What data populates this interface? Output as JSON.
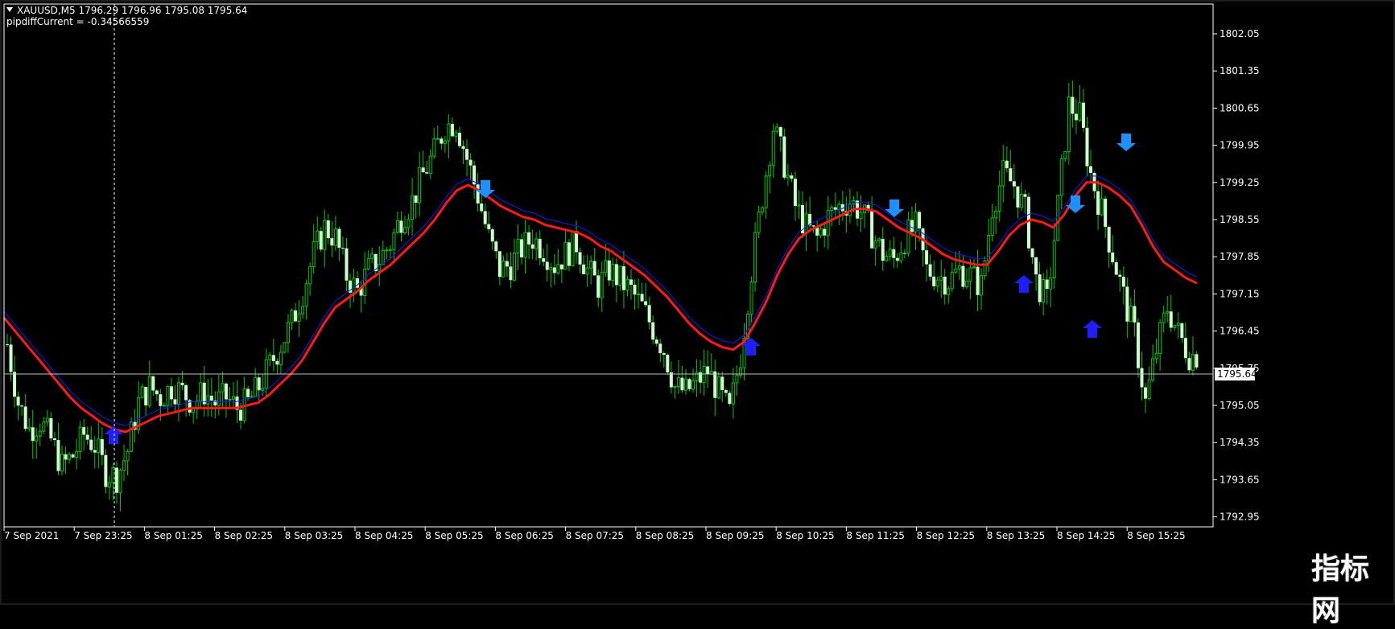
{
  "header": {
    "symbol_line": "XAUUSD,M5  1796.29 1796.96 1795.08 1795.64",
    "indicator_line": "pipdiffCurrent = -0.34566559"
  },
  "current_price_label": "1795.64",
  "watermark_text": "指标网",
  "colors": {
    "background": "#000000",
    "grid_frame": "#ffffff",
    "candle_up_body": "#000000",
    "candle_wick": "#00c800",
    "candle_down_body": "#ccffcc",
    "ema_red": "#ff1a1a",
    "ema_blue": "#1a1aff",
    "arrow_up": "#1e1eff",
    "arrow_down": "#1e90ff",
    "price_line": "#c0c0c0"
  },
  "chart_data": {
    "type": "candlestick",
    "symbol": "XAUUSD",
    "timeframe": "M5",
    "ylim": [
      1792.6,
      1802.4
    ],
    "y_ticks": [
      "1802.05",
      "1801.35",
      "1800.65",
      "1799.95",
      "1799.25",
      "1798.55",
      "1797.85",
      "1797.15",
      "1796.45",
      "1795.75",
      "1795.05",
      "1794.35",
      "1793.65",
      "1792.95"
    ],
    "x_ticks": [
      "7 Sep 2021",
      "7 Sep 23:25",
      "8 Sep 01:25",
      "8 Sep 02:25",
      "8 Sep 03:25",
      "8 Sep 04:25",
      "8 Sep 05:25",
      "8 Sep 06:25",
      "8 Sep 07:25",
      "8 Sep 08:25",
      "8 Sep 09:25",
      "8 Sep 10:25",
      "8 Sep 11:25",
      "8 Sep 12:25",
      "8 Sep 13:25",
      "8 Sep 14:25",
      "8 Sep 15:25"
    ],
    "current_price": 1795.64,
    "close_path": [
      1796.2,
      1795.1,
      1794.6,
      1794.75,
      1794.4,
      1793.9,
      1794.1,
      1794.5,
      1794.3,
      1793.8,
      1793.7,
      1794.2,
      1795.1,
      1795.4,
      1795.2,
      1795.4,
      1795.3,
      1795.1,
      1795.3,
      1795.1,
      1795.2,
      1795.0,
      1795.1,
      1795.4,
      1795.8,
      1796.2,
      1796.6,
      1797.2,
      1797.9,
      1798.4,
      1798.2,
      1797.5,
      1797.2,
      1797.6,
      1797.8,
      1798.1,
      1798.6,
      1798.9,
      1799.4,
      1799.8,
      1800.3,
      1800.4,
      1799.7,
      1799.0,
      1798.2,
      1797.6,
      1797.7,
      1798.0,
      1798.2,
      1798.0,
      1797.7,
      1797.9,
      1798.1,
      1797.6,
      1797.3,
      1797.6,
      1797.4,
      1797.2,
      1796.9,
      1796.5,
      1796.1,
      1795.4,
      1795.3,
      1795.5,
      1795.7,
      1795.3,
      1794.9,
      1796.0,
      1797.6,
      1799.0,
      1800.3,
      1799.6,
      1798.8,
      1798.4,
      1798.2,
      1798.6,
      1798.8,
      1798.9,
      1798.7,
      1798.3,
      1797.9,
      1797.8,
      1798.2,
      1798.4,
      1797.6,
      1797.5,
      1797.4,
      1797.6,
      1797.5,
      1797.3,
      1798.8,
      1799.4,
      1799.2,
      1798.7,
      1797.4,
      1797.0,
      1798.8,
      1800.7,
      1800.5,
      1799.4,
      1798.7,
      1797.9,
      1797.1,
      1796.4,
      1795.1,
      1796.1,
      1796.9,
      1796.4,
      1796.0
    ],
    "ema_red": [
      1796.7,
      1796.45,
      1796.2,
      1795.95,
      1795.7,
      1795.45,
      1795.2,
      1795.0,
      1794.85,
      1794.7,
      1794.6,
      1794.55,
      1794.65,
      1794.75,
      1794.85,
      1794.9,
      1794.95,
      1795.0,
      1795.0,
      1795.0,
      1795.0,
      1795.0,
      1795.05,
      1795.1,
      1795.25,
      1795.45,
      1795.65,
      1795.9,
      1796.25,
      1796.6,
      1796.9,
      1797.05,
      1797.2,
      1797.4,
      1797.55,
      1797.7,
      1797.9,
      1798.1,
      1798.3,
      1798.55,
      1798.85,
      1799.1,
      1799.2,
      1799.1,
      1798.95,
      1798.8,
      1798.7,
      1798.6,
      1798.55,
      1798.45,
      1798.4,
      1798.35,
      1798.3,
      1798.2,
      1798.05,
      1797.95,
      1797.8,
      1797.65,
      1797.5,
      1797.3,
      1797.1,
      1796.85,
      1796.6,
      1796.4,
      1796.25,
      1796.15,
      1796.1,
      1796.25,
      1796.6,
      1797.0,
      1797.5,
      1797.9,
      1798.2,
      1798.35,
      1798.45,
      1798.55,
      1798.65,
      1798.75,
      1798.75,
      1798.7,
      1798.55,
      1798.4,
      1798.3,
      1798.2,
      1798.05,
      1797.9,
      1797.8,
      1797.75,
      1797.7,
      1797.7,
      1797.95,
      1798.25,
      1798.45,
      1798.55,
      1798.5,
      1798.4,
      1798.65,
      1799.0,
      1799.25,
      1799.25,
      1799.15,
      1799.0,
      1798.8,
      1798.45,
      1798.05,
      1797.75,
      1797.6,
      1797.45,
      1797.35
    ]
  }
}
